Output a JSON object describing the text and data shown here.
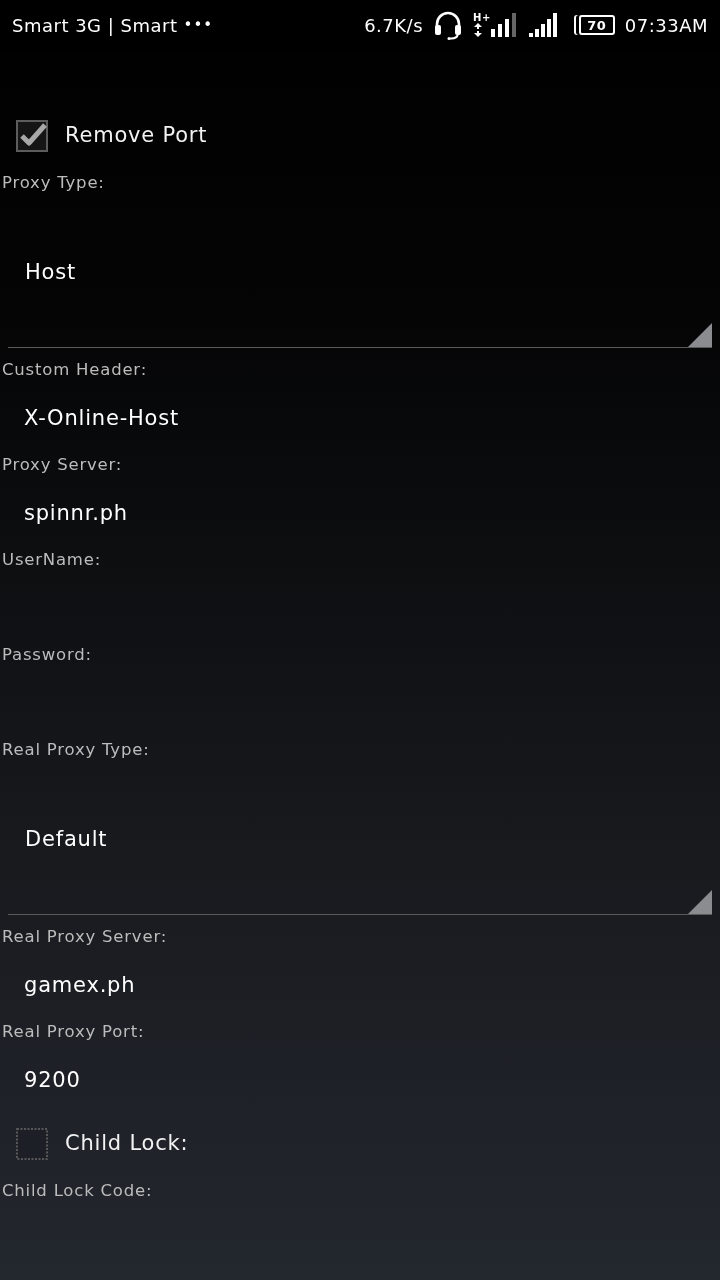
{
  "status_bar": {
    "carrier": "Smart 3G | Smart",
    "more": "•••",
    "speed": "6.7K/s",
    "network_type": "H+",
    "battery": "70",
    "time": "07:33AM"
  },
  "form": [
    {
      "kind": "checkbox",
      "label": "Remove Port",
      "checked": true
    },
    {
      "kind": "spinner",
      "label": "Proxy Type:",
      "value": "Host"
    },
    {
      "kind": "text",
      "label": "Custom Header:",
      "value": "X-Online-Host"
    },
    {
      "kind": "text",
      "label": "Proxy Server:",
      "value": "spinnr.ph"
    },
    {
      "kind": "text",
      "label": "UserName:"
    },
    {
      "kind": "text",
      "label": "Password:"
    },
    {
      "kind": "spinner",
      "label": "Real Proxy Type:",
      "value": "Default"
    },
    {
      "kind": "text",
      "label": "Real Proxy Server:",
      "value": "gamex.ph"
    },
    {
      "kind": "text",
      "label": "Real Proxy Port:",
      "value": "9200"
    },
    {
      "kind": "checkbox",
      "label": "Child Lock:",
      "checked": false
    },
    {
      "kind": "text",
      "label": "Child Lock Code:"
    }
  ]
}
